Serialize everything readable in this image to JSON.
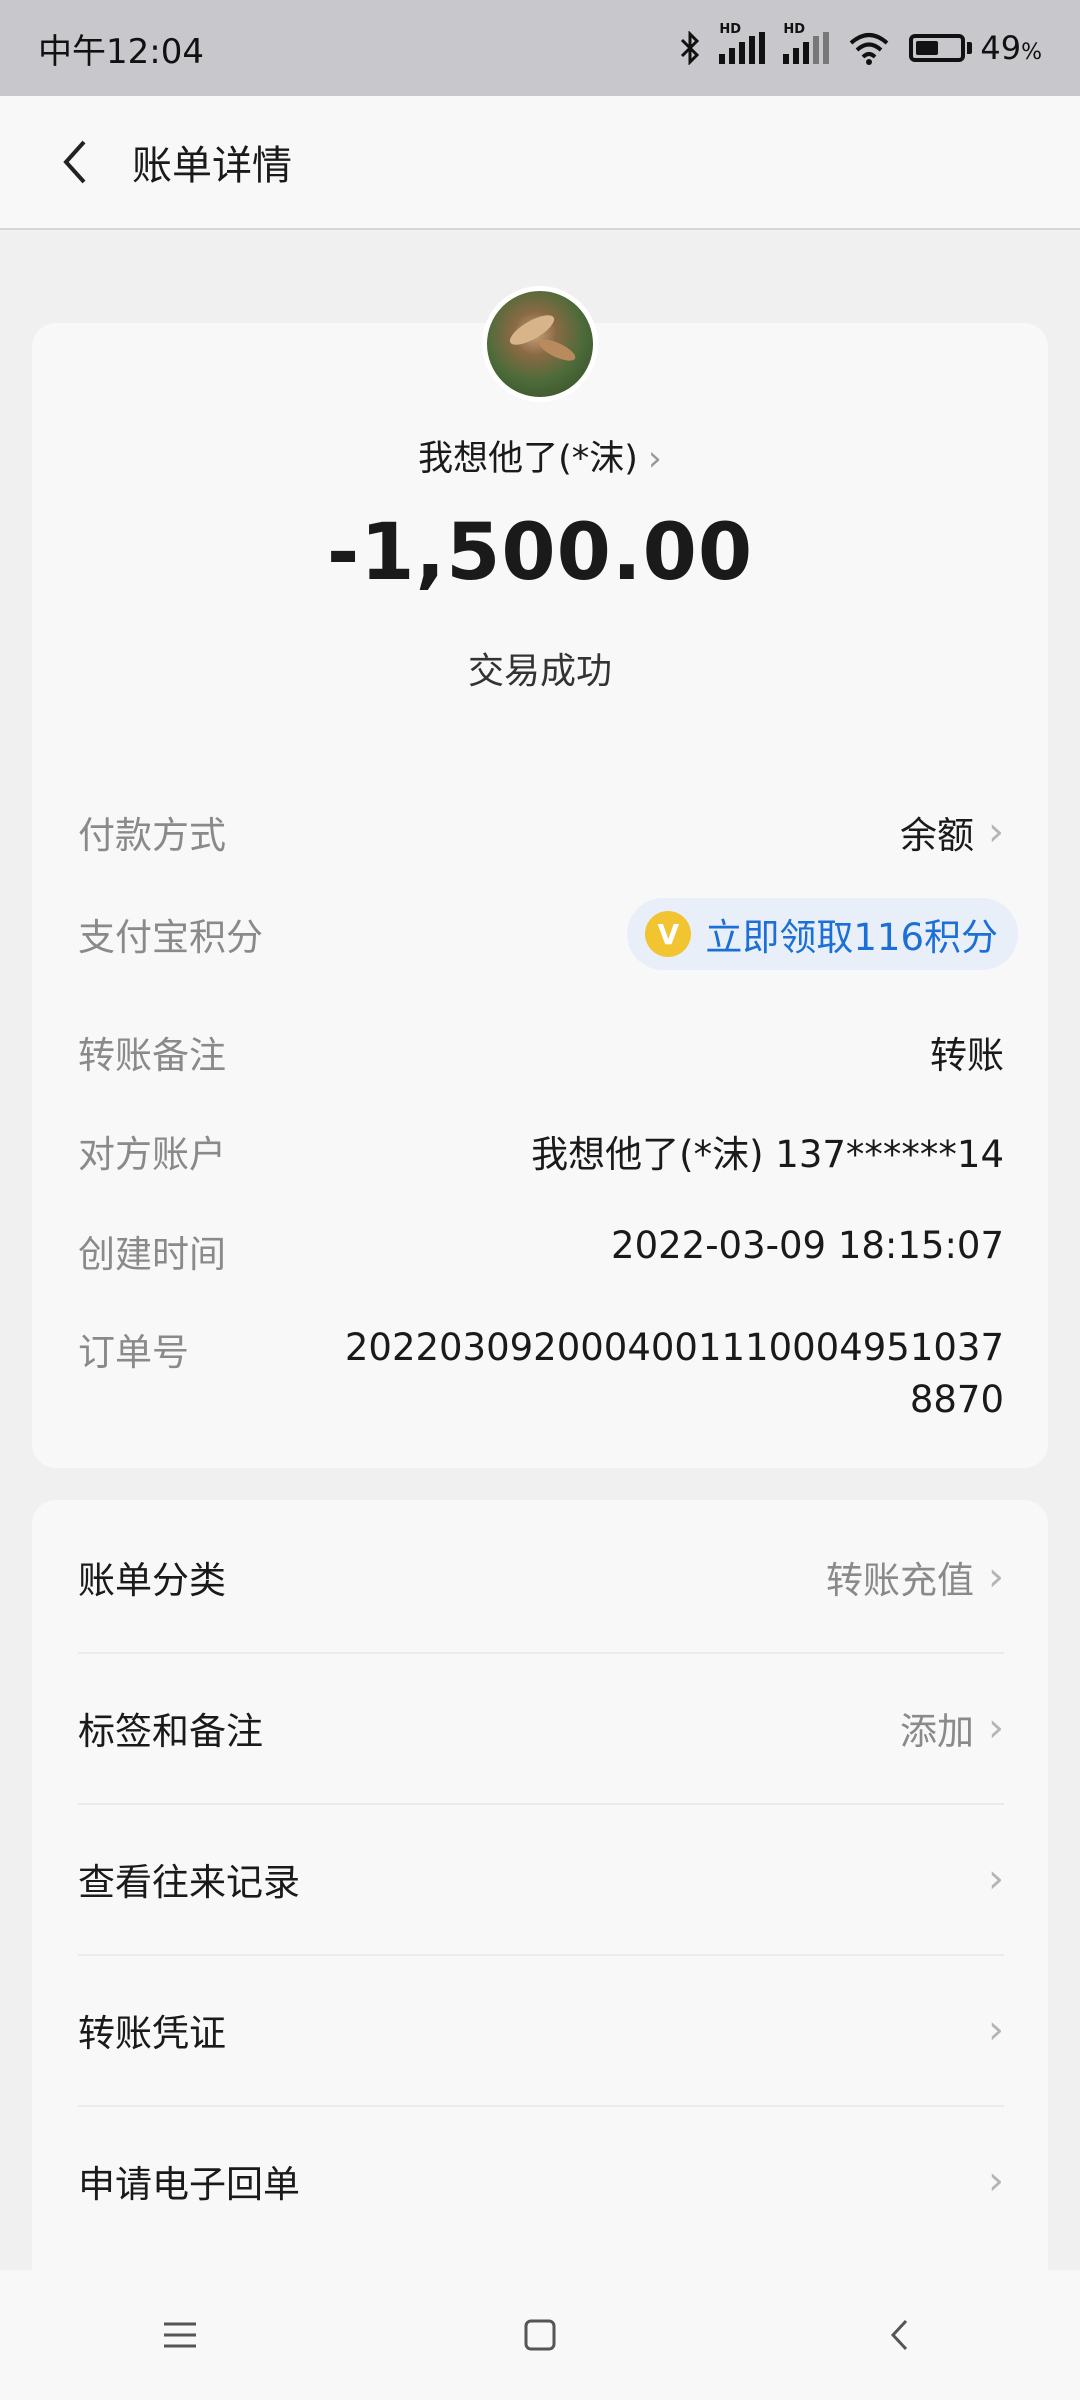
{
  "status_bar": {
    "time": "中午12:04",
    "battery": "49",
    "battery_unit": "%",
    "hd1": "HD",
    "hd2": "HD"
  },
  "header": {
    "title": "账单详情"
  },
  "summary": {
    "payee": "我想他了(*沫)",
    "amount": "-1,500.00",
    "status": "交易成功"
  },
  "details": [
    {
      "label": "付款方式",
      "value": "余额"
    },
    {
      "label": "支付宝积分",
      "value": "立即领取116积分",
      "coin": "V"
    },
    {
      "label": "转账备注",
      "value": "转账"
    },
    {
      "label": "对方账户",
      "value": "我想他了(*沫) 137******14"
    },
    {
      "label": "创建时间",
      "value": "2022-03-09 18:15:07"
    },
    {
      "label": "订单号",
      "value_line1": "2022030920004001110004951037",
      "value_line2": "8870"
    }
  ],
  "menu": [
    {
      "label": "账单分类",
      "value": "转账充值"
    },
    {
      "label": "标签和备注",
      "value": "添加"
    },
    {
      "label": "查看往来记录",
      "value": ""
    },
    {
      "label": "转账凭证",
      "value": ""
    },
    {
      "label": "申请电子回单",
      "value": ""
    }
  ],
  "colors": {
    "accent": "#1c6fd6",
    "coin": "#f3c431"
  }
}
